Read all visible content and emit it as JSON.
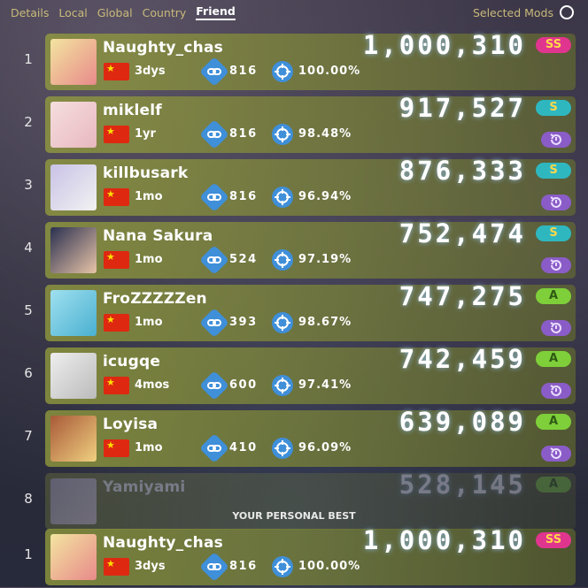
{
  "tabs": [
    {
      "label": "Details"
    },
    {
      "label": "Local"
    },
    {
      "label": "Global"
    },
    {
      "label": "Country"
    },
    {
      "label": "Friend"
    }
  ],
  "selected_mods_label": "Selected Mods",
  "personal_best_label": "YOUR PERSONAL BEST",
  "rows": [
    {
      "rank": "1",
      "name": "Naughty_chas",
      "time": "3dys",
      "combo": "816",
      "acc": "100.00%",
      "score": "1,000,310",
      "grade": "SS"
    },
    {
      "rank": "2",
      "name": "miklelf",
      "time": "1yr",
      "combo": "816",
      "acc": "98.48%",
      "score": "917,527",
      "grade": "S"
    },
    {
      "rank": "3",
      "name": "killbusark",
      "time": "1mo",
      "combo": "816",
      "acc": "96.94%",
      "score": "876,333",
      "grade": "S"
    },
    {
      "rank": "4",
      "name": "Nana Sakura",
      "time": "1mo",
      "combo": "524",
      "acc": "97.19%",
      "score": "752,474",
      "grade": "S"
    },
    {
      "rank": "5",
      "name": "FroZZZZZen",
      "time": "1mo",
      "combo": "393",
      "acc": "98.67%",
      "score": "747,275",
      "grade": "A"
    },
    {
      "rank": "6",
      "name": "icugqe",
      "time": "4mos",
      "combo": "600",
      "acc": "97.41%",
      "score": "742,459",
      "grade": "A"
    },
    {
      "rank": "7",
      "name": "Loyisa",
      "time": "1mo",
      "combo": "410",
      "acc": "96.09%",
      "score": "639,089",
      "grade": "A"
    },
    {
      "rank": "8",
      "name": "Yamiyami",
      "score": "528,145",
      "grade": "A"
    }
  ],
  "personal_best": {
    "rank": "1",
    "name": "Naughty_chas",
    "time": "3dys",
    "combo": "816",
    "acc": "100.00%",
    "score": "1,000,310",
    "grade": "SS"
  },
  "icons": {
    "combo": "link-icon",
    "accuracy": "crosshair-icon",
    "mods": "replay-mod-icon",
    "flag": "china-flag-icon"
  }
}
